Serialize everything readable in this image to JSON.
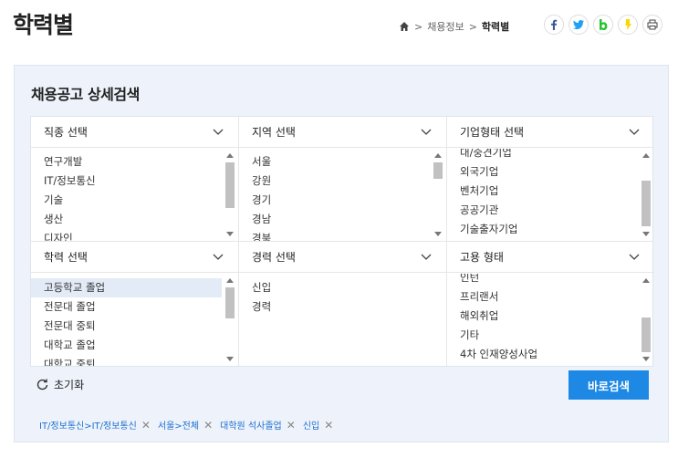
{
  "page": {
    "title": "학력별"
  },
  "breadcrumb": {
    "items": [
      "채용정보",
      "학력별"
    ],
    "separator": ">"
  },
  "share": {
    "facebook": "f",
    "twitter": "t",
    "band": "b",
    "kakao": "k",
    "colors": {
      "facebook": "#3b5998",
      "twitter": "#1da1f2",
      "band": "#26c32e",
      "kakao": "#f7d800"
    }
  },
  "panel": {
    "title": "채용공고 상세검색",
    "filters": [
      {
        "label": "직종 선택",
        "items": [
          "연구개발",
          "IT/정보통신",
          "기술",
          "생산",
          "디자인"
        ]
      },
      {
        "label": "지역 선택",
        "items": [
          "서울",
          "강원",
          "경기",
          "경남",
          "경북"
        ]
      },
      {
        "label": "기업형태 선택",
        "items": [
          "대/중견기업",
          "외국기업",
          "벤처기업",
          "공공기관",
          "기술출자기업"
        ]
      },
      {
        "label": "학력 선택",
        "items": [
          "고등학교 졸업",
          "전문대 졸업",
          "전문대 중퇴",
          "대학교 졸업",
          "대학교 중퇴"
        ]
      },
      {
        "label": "경력 선택",
        "items": [
          "신입",
          "경력"
        ]
      },
      {
        "label": "고용 형태",
        "items": [
          "인턴",
          "프리랜서",
          "해외취업",
          "기타",
          "4차 인재양성사업"
        ]
      }
    ],
    "reset_label": "초기화",
    "search_label": "바로검색",
    "tags": [
      "IT/정보통신>IT/정보통신",
      "서울>전체",
      "대학원 석사졸업",
      "신입"
    ],
    "accent": "#1e88e5"
  }
}
